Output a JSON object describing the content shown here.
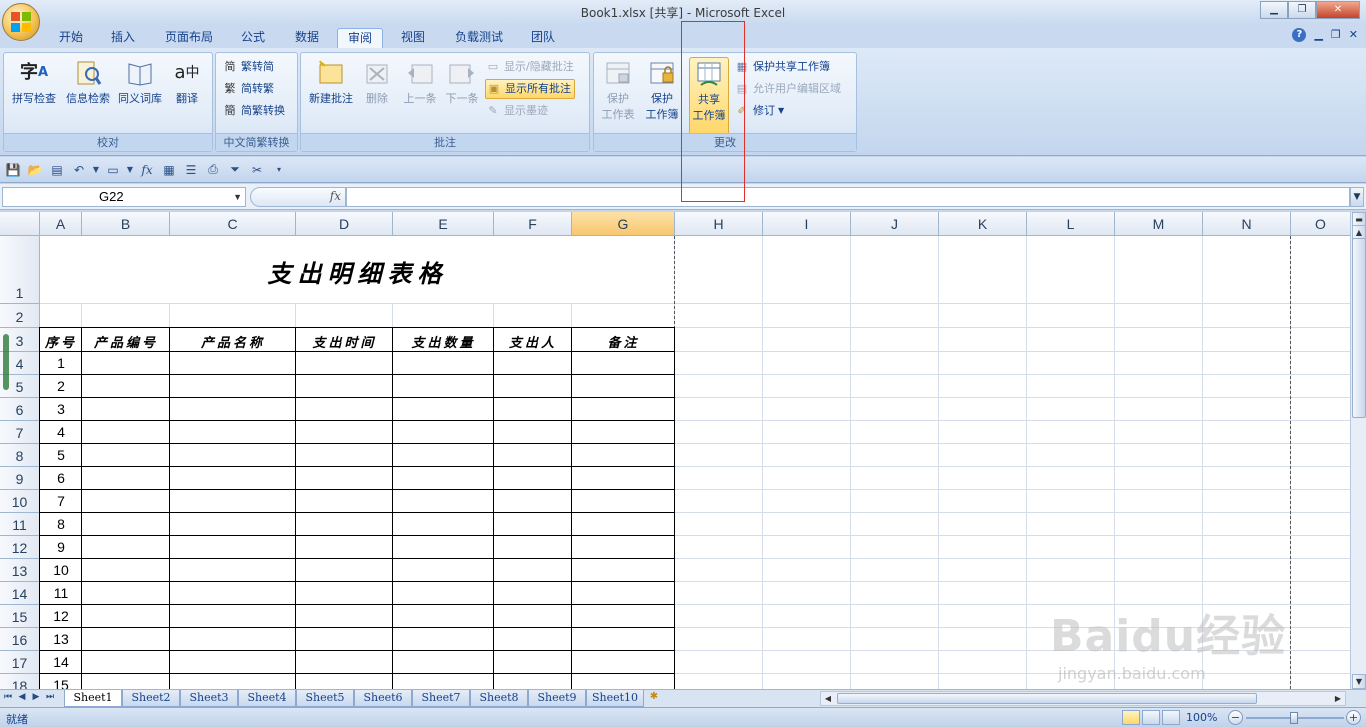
{
  "window": {
    "title": "Book1.xlsx  [共享] - Microsoft Excel"
  },
  "tabs": [
    "开始",
    "插入",
    "页面布局",
    "公式",
    "数据",
    "审阅",
    "视图",
    "负载测试",
    "团队"
  ],
  "active_tab": "审阅",
  "ribbon": {
    "proofing": {
      "label": "校对",
      "spelling": "拼写检查",
      "research": "信息检索",
      "thesaurus": "同义词库",
      "translate": "翻译"
    },
    "chinese_conversion": {
      "label": "中文简繁转换",
      "to_simplified": "繁转简",
      "to_traditional": "简转繁",
      "conversion": "简繁转换"
    },
    "comments": {
      "label": "批注",
      "new_comment": "新建批注",
      "delete": "删除",
      "previous": "上一条",
      "next": "下一条",
      "show_hide": "显示/隐藏批注",
      "show_all": "显示所有批注",
      "show_ink": "显示墨迹"
    },
    "changes": {
      "label": "更改",
      "protect_sheet_1": "保护",
      "protect_sheet_2": "工作表",
      "protect_workbook_1": "保护",
      "protect_workbook_2": "工作簿",
      "share_workbook_1": "共享",
      "share_workbook_2": "工作簿",
      "protect_shared": "保护共享工作簿",
      "allow_edit_ranges": "允许用户编辑区域",
      "track_changes": "修订"
    }
  },
  "formula_bar": {
    "cell_ref": "G22",
    "fx": "fx",
    "value": ""
  },
  "columns": [
    "A",
    "B",
    "C",
    "D",
    "E",
    "F",
    "G",
    "H",
    "I",
    "J",
    "K",
    "L",
    "M",
    "N",
    "O"
  ],
  "selected_column": "G",
  "rows": [
    "1",
    "2",
    "3",
    "4",
    "5",
    "6",
    "7",
    "8",
    "9",
    "10",
    "11",
    "12",
    "13",
    "14",
    "15",
    "16",
    "17",
    "18"
  ],
  "sheet": {
    "title": "支出明细表格",
    "headers": [
      "序号",
      "产品编号",
      "产品名称",
      "支出时间",
      "支出数量",
      "支出人",
      "备注"
    ],
    "serials": [
      "1",
      "2",
      "3",
      "4",
      "5",
      "6",
      "7",
      "8",
      "9",
      "10",
      "11",
      "12",
      "13",
      "14",
      "15"
    ]
  },
  "sheet_tabs": [
    "Sheet1",
    "Sheet2",
    "Sheet3",
    "Sheet4",
    "Sheet5",
    "Sheet6",
    "Sheet7",
    "Sheet8",
    "Sheet9",
    "Sheet10"
  ],
  "active_sheet": "Sheet1",
  "status": {
    "ready": "就绪",
    "zoom": "100%"
  },
  "watermark": {
    "brand": "Baidu经验",
    "url": "jingyan.baidu.com"
  },
  "icons": {
    "office": "office-button-icon",
    "help": "help-icon"
  },
  "colors": {
    "accent": "#15428b",
    "selected_header": "#f8c770",
    "highlight": "#e0302a"
  }
}
